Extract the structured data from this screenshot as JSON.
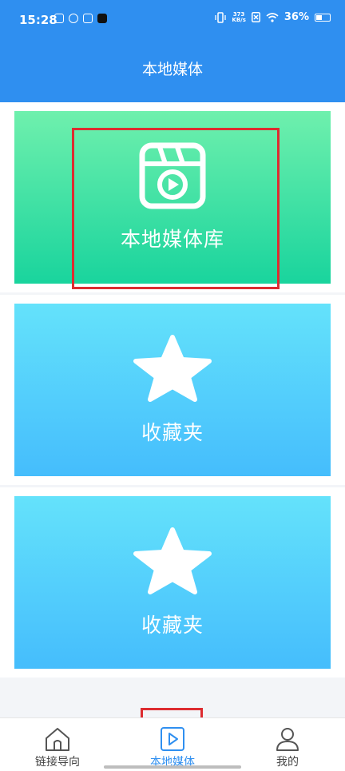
{
  "status_bar": {
    "time": "15:28",
    "net_speed_top": "373",
    "net_speed_bottom": "KB/s",
    "battery_percent": "36%"
  },
  "header": {
    "title": "本地媒体"
  },
  "cards": [
    {
      "label": "本地媒体库",
      "icon": "video-clapper-icon"
    },
    {
      "label": "收藏夹",
      "icon": "star-icon"
    },
    {
      "label": "收藏夹",
      "icon": "star-icon"
    }
  ],
  "bottom_nav": {
    "items": [
      {
        "label": "链接导向",
        "icon": "home-icon",
        "active": false
      },
      {
        "label": "本地媒体",
        "icon": "play-square-icon",
        "active": true
      },
      {
        "label": "我的",
        "icon": "user-icon",
        "active": false
      }
    ]
  },
  "colors": {
    "brand_blue": "#2f8ff0",
    "highlight_red": "#dd2c30",
    "green_card_top": "#6ff0ad",
    "green_card_bottom": "#19d49d",
    "blue_card_top": "#64e2fb",
    "blue_card_bottom": "#45bdfc"
  }
}
